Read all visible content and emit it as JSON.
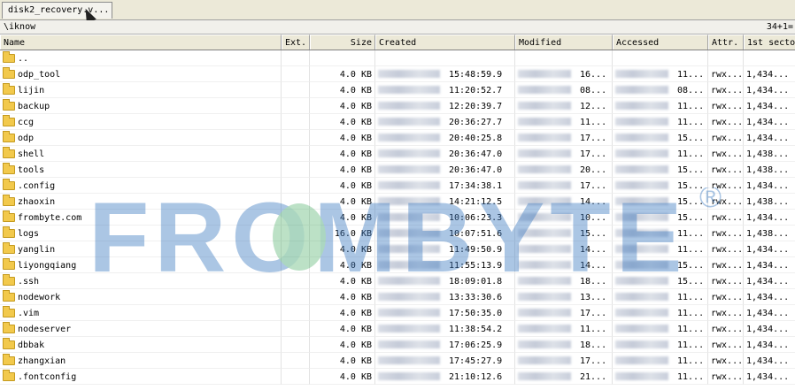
{
  "tab": {
    "label": "disk2_recovery.v..."
  },
  "pathbar": {
    "path": "\\iknow",
    "count": "34+1="
  },
  "columns": {
    "name": "Name",
    "ext": "Ext.",
    "size": "Size",
    "created": "Created",
    "modified": "Modified",
    "accessed": "Accessed",
    "attr": "Attr.",
    "sector": "1st secto"
  },
  "watermark": {
    "text": "FROMBYTE",
    "mark": "®"
  },
  "rows": [
    {
      "name": "..",
      "size": "",
      "created": "",
      "modified": "",
      "accessed": "",
      "attr": "",
      "sector": ""
    },
    {
      "name": "odp_tool",
      "size": "4.0 KB",
      "created": "15:48:59.9",
      "modified": "16...",
      "accessed": "11...",
      "attr": "rwx...",
      "sector": "1,434..."
    },
    {
      "name": "lijin",
      "size": "4.0 KB",
      "created": "11:20:52.7",
      "modified": "08...",
      "accessed": "08...",
      "attr": "rwx...",
      "sector": "1,434..."
    },
    {
      "name": "backup",
      "size": "4.0 KB",
      "created": "12:20:39.7",
      "modified": "12...",
      "accessed": "11...",
      "attr": "rwx...",
      "sector": "1,434..."
    },
    {
      "name": "ccg",
      "size": "4.0 KB",
      "created": "20:36:27.7",
      "modified": "11...",
      "accessed": "11...",
      "attr": "rwx...",
      "sector": "1,434..."
    },
    {
      "name": "odp",
      "size": "4.0 KB",
      "created": "20:40:25.8",
      "modified": "17...",
      "accessed": "15...",
      "attr": "rwx...",
      "sector": "1,434..."
    },
    {
      "name": "shell",
      "size": "4.0 KB",
      "created": "20:36:47.0",
      "modified": "17...",
      "accessed": "11...",
      "attr": "rwx...",
      "sector": "1,438..."
    },
    {
      "name": "tools",
      "size": "4.0 KB",
      "created": "20:36:47.0",
      "modified": "20...",
      "accessed": "15...",
      "attr": "rwx...",
      "sector": "1,438..."
    },
    {
      "name": ".config",
      "size": "4.0 KB",
      "created": "17:34:38.1",
      "modified": "17...",
      "accessed": "15...",
      "attr": "rwx...",
      "sector": "1,434..."
    },
    {
      "name": "zhaoxin",
      "size": "4.0 KB",
      "created": "14:21:12.5",
      "modified": "14...",
      "accessed": "15...",
      "attr": "rwx...",
      "sector": "1,438..."
    },
    {
      "name": "frombyte.com",
      "size": "4.0 KB",
      "created": "10:06:23.3",
      "modified": "10...",
      "accessed": "15...",
      "attr": "rwx...",
      "sector": "1,434..."
    },
    {
      "name": "logs",
      "size": "16.0 KB",
      "created": "10:07:51.6",
      "modified": "15...",
      "accessed": "11...",
      "attr": "rwx...",
      "sector": "1,438..."
    },
    {
      "name": "yanglin",
      "size": "4.0 KB",
      "created": "11:49:50.9",
      "modified": "14...",
      "accessed": "11...",
      "attr": "rwx...",
      "sector": "1,434..."
    },
    {
      "name": "liyongqiang",
      "size": "4.0 KB",
      "created": "11:55:13.9",
      "modified": "14...",
      "accessed": "15...",
      "attr": "rwx...",
      "sector": "1,434..."
    },
    {
      "name": ".ssh",
      "size": "4.0 KB",
      "created": "18:09:01.8",
      "modified": "18...",
      "accessed": "15...",
      "attr": "rwx...",
      "sector": "1,434..."
    },
    {
      "name": "nodework",
      "size": "4.0 KB",
      "created": "13:33:30.6",
      "modified": "13...",
      "accessed": "11...",
      "attr": "rwx...",
      "sector": "1,434..."
    },
    {
      "name": ".vim",
      "size": "4.0 KB",
      "created": "17:50:35.0",
      "modified": "17...",
      "accessed": "11...",
      "attr": "rwx...",
      "sector": "1,434..."
    },
    {
      "name": "nodeserver",
      "size": "4.0 KB",
      "created": "11:38:54.2",
      "modified": "11...",
      "accessed": "11...",
      "attr": "rwx...",
      "sector": "1,434..."
    },
    {
      "name": "dbbak",
      "size": "4.0 KB",
      "created": "17:06:25.9",
      "modified": "18...",
      "accessed": "11...",
      "attr": "rwx...",
      "sector": "1,434..."
    },
    {
      "name": "zhangxian",
      "size": "4.0 KB",
      "created": "17:45:27.9",
      "modified": "17...",
      "accessed": "11...",
      "attr": "rwx...",
      "sector": "1,434..."
    },
    {
      "name": ".fontconfig",
      "size": "4.0 KB",
      "created": "21:10:12.6",
      "modified": "21...",
      "accessed": "11...",
      "attr": "rwx...",
      "sector": "1,434..."
    }
  ],
  "colors": {
    "folder": "#f2c94c",
    "header_bg": "#ece9d8",
    "watermark_blue": "#3a78c0",
    "watermark_green": "#3aa858"
  }
}
